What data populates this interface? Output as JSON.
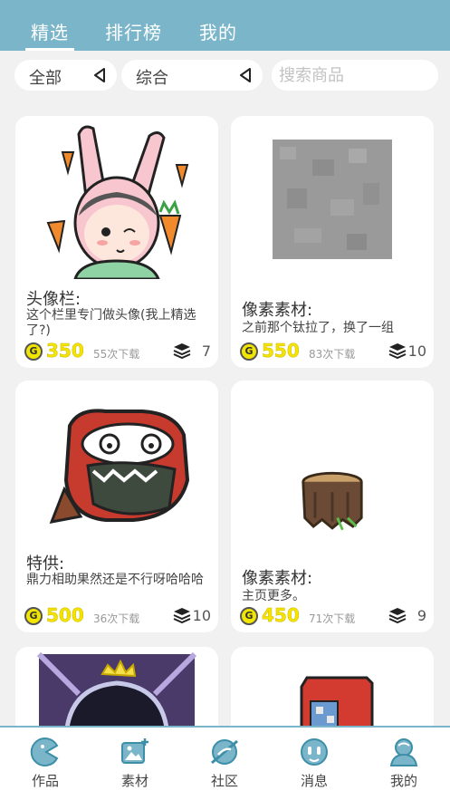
{
  "top_tabs": [
    {
      "label": "精选",
      "active": true
    },
    {
      "label": "排行榜",
      "active": false
    },
    {
      "label": "我的",
      "active": false
    }
  ],
  "filters": {
    "category": "全部",
    "sort": "综合",
    "search_placeholder": "搜索商品"
  },
  "cards": [
    {
      "title": "头像栏:",
      "desc": "这个栏里专门做头像(我上精选了?)",
      "price": "350",
      "downloads": "55次下载",
      "count": "7"
    },
    {
      "title": "像素素材:",
      "desc": "之前那个钛拉了，换了一组",
      "price": "550",
      "downloads": "83次下载",
      "count": "10"
    },
    {
      "title": "特供:",
      "desc": "鼎力相助果然还是不行呀哈哈哈",
      "price": "500",
      "downloads": "36次下载",
      "count": "10"
    },
    {
      "title": "像素素材:",
      "desc": "主页更多。",
      "price": "450",
      "downloads": "71次下载",
      "count": "9"
    }
  ],
  "coin_glyph": "G",
  "bottom_nav": [
    {
      "label": "作品",
      "icon": "pacman-icon"
    },
    {
      "label": "素材",
      "icon": "image-add-icon"
    },
    {
      "label": "社区",
      "icon": "planet-icon"
    },
    {
      "label": "消息",
      "icon": "chat-face-icon"
    },
    {
      "label": "我的",
      "icon": "user-icon"
    }
  ],
  "colors": {
    "header": "#7ab5c9",
    "price": "#f5e400",
    "background": "#f1f1f1"
  }
}
